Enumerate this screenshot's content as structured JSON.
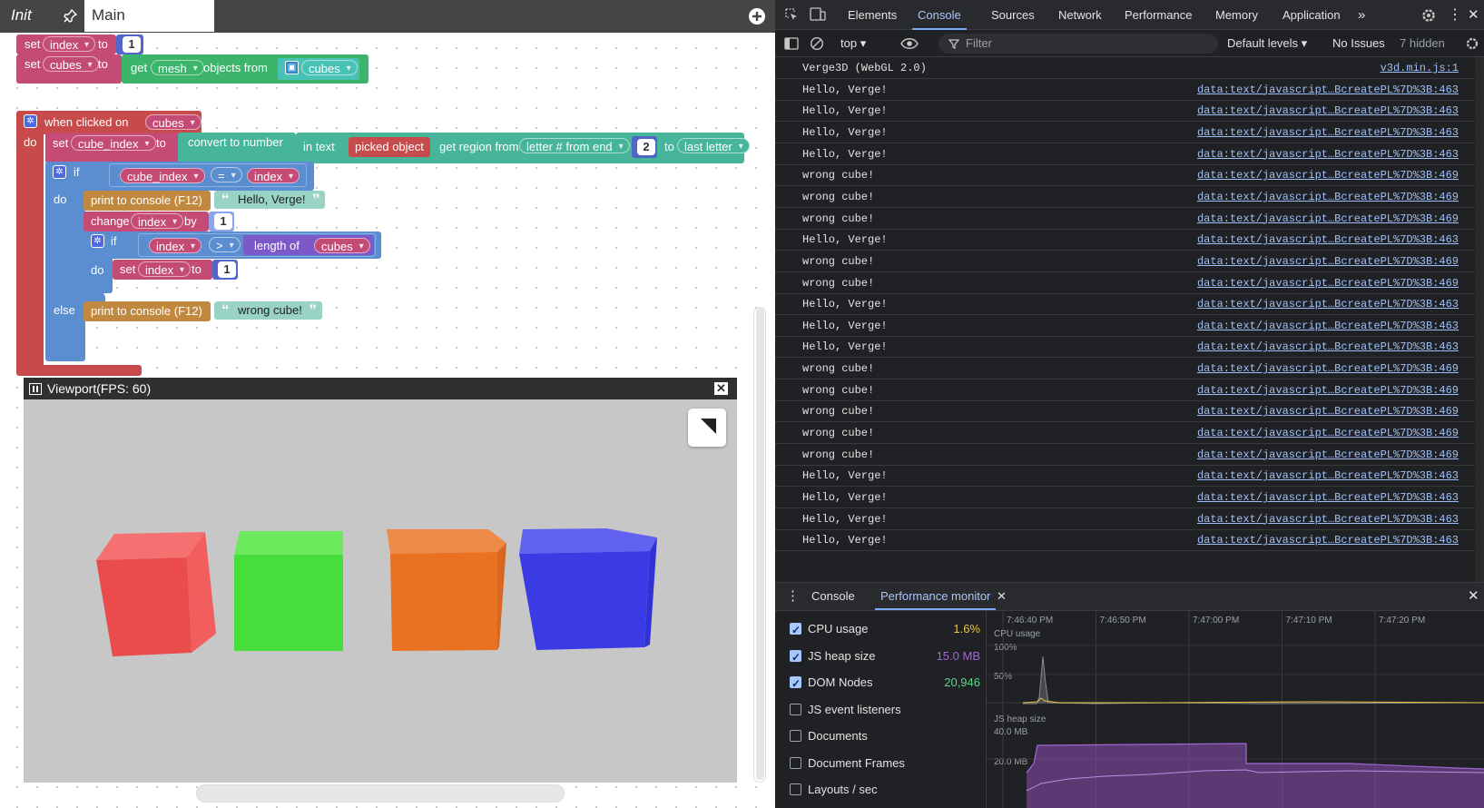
{
  "editor": {
    "tabs": {
      "init": "Init",
      "main": "Main"
    },
    "blocks": {
      "set1": {
        "set": "set",
        "var": "index",
        "to": "to",
        "value": "1"
      },
      "set2": {
        "set": "set",
        "var": "cubes",
        "to": "to",
        "get": "get",
        "type": "mesh",
        "objects_from": "objects from",
        "collection": "cubes"
      },
      "event": {
        "when_clicked_on": "when clicked on",
        "target": "cubes",
        "do": "do"
      },
      "set_cube_index": {
        "set": "set",
        "var": "cube_index",
        "to": "to",
        "convert": "convert to number",
        "in_text": "in text",
        "picked": "picked object",
        "region": "get region from",
        "letter_mode": "letter # from end",
        "n": "2",
        "to2": "to",
        "last_letter": "last letter"
      },
      "if1": {
        "if": "if",
        "left": "cube_index",
        "op": "=",
        "right": "index",
        "do": "do",
        "else": "else"
      },
      "print1": {
        "label": "print to console (F12)",
        "text": "Hello, Verge!"
      },
      "change": {
        "label": "change",
        "var": "index",
        "by": "by",
        "value": "1"
      },
      "if2": {
        "if": "if",
        "left": "index",
        "op": ">",
        "length_of": "length of",
        "list": "cubes",
        "do": "do"
      },
      "set_index": {
        "set": "set",
        "var": "index",
        "to": "to",
        "value": "1"
      },
      "print2": {
        "label": "print to console (F12)",
        "text": "wrong cube!"
      }
    },
    "viewport": {
      "title": "Viewport(FPS: 60)"
    },
    "cubes": [
      {
        "name": "red-cube",
        "front": "#ea4c4c",
        "side": "#f25e5e",
        "top": "#f57171"
      },
      {
        "name": "green-cube",
        "front": "#47dd3a",
        "side": "#53e445",
        "top": "#6bea5e"
      },
      {
        "name": "orange-cube",
        "front": "#e97222",
        "side": "#d8661c",
        "top": "#ef8a48"
      },
      {
        "name": "blue-cube",
        "front": "#3b3be6",
        "side": "#3232d4",
        "top": "#6161ef"
      }
    ]
  },
  "devtools": {
    "tabs": [
      "Elements",
      "Console",
      "Sources",
      "Network",
      "Performance",
      "Memory",
      "Application"
    ],
    "active_tab": "Console",
    "toolbar": {
      "context": "top",
      "filter_placeholder": "Filter",
      "levels": "Default levels",
      "issues": "No Issues",
      "hidden": "7 hidden"
    },
    "log": [
      {
        "msg": "Verge3D (WebGL 2.0)",
        "src": "v3d.min.js:1"
      },
      {
        "msg": "Hello, Verge!",
        "src": "data:text/javascript…BcreatePL%7D%3B:463"
      },
      {
        "msg": "Hello, Verge!",
        "src": "data:text/javascript…BcreatePL%7D%3B:463"
      },
      {
        "msg": "Hello, Verge!",
        "src": "data:text/javascript…BcreatePL%7D%3B:463"
      },
      {
        "msg": "Hello, Verge!",
        "src": "data:text/javascript…BcreatePL%7D%3B:463"
      },
      {
        "msg": "wrong cube!",
        "src": "data:text/javascript…BcreatePL%7D%3B:469"
      },
      {
        "msg": "wrong cube!",
        "src": "data:text/javascript…BcreatePL%7D%3B:469"
      },
      {
        "msg": "wrong cube!",
        "src": "data:text/javascript…BcreatePL%7D%3B:469"
      },
      {
        "msg": "Hello, Verge!",
        "src": "data:text/javascript…BcreatePL%7D%3B:463"
      },
      {
        "msg": "wrong cube!",
        "src": "data:text/javascript…BcreatePL%7D%3B:469"
      },
      {
        "msg": "wrong cube!",
        "src": "data:text/javascript…BcreatePL%7D%3B:469"
      },
      {
        "msg": "Hello, Verge!",
        "src": "data:text/javascript…BcreatePL%7D%3B:463"
      },
      {
        "msg": "Hello, Verge!",
        "src": "data:text/javascript…BcreatePL%7D%3B:463"
      },
      {
        "msg": "Hello, Verge!",
        "src": "data:text/javascript…BcreatePL%7D%3B:463"
      },
      {
        "msg": "wrong cube!",
        "src": "data:text/javascript…BcreatePL%7D%3B:469"
      },
      {
        "msg": "wrong cube!",
        "src": "data:text/javascript…BcreatePL%7D%3B:469"
      },
      {
        "msg": "wrong cube!",
        "src": "data:text/javascript…BcreatePL%7D%3B:469"
      },
      {
        "msg": "wrong cube!",
        "src": "data:text/javascript…BcreatePL%7D%3B:469"
      },
      {
        "msg": "wrong cube!",
        "src": "data:text/javascript…BcreatePL%7D%3B:469"
      },
      {
        "msg": "Hello, Verge!",
        "src": "data:text/javascript…BcreatePL%7D%3B:463"
      },
      {
        "msg": "Hello, Verge!",
        "src": "data:text/javascript…BcreatePL%7D%3B:463"
      },
      {
        "msg": "Hello, Verge!",
        "src": "data:text/javascript…BcreatePL%7D%3B:463"
      },
      {
        "msg": "Hello, Verge!",
        "src": "data:text/javascript…BcreatePL%7D%3B:463"
      }
    ],
    "drawer": {
      "tabs": [
        "Console",
        "Performance monitor"
      ],
      "active": "Performance monitor"
    },
    "perf": {
      "items": [
        {
          "label": "CPU usage",
          "value": "1.6%",
          "color": "#e8c34a",
          "checked": true
        },
        {
          "label": "JS heap size",
          "value": "15.0 MB",
          "color": "#a365d6",
          "checked": true
        },
        {
          "label": "DOM Nodes",
          "value": "20,946",
          "color": "#5fd38c",
          "checked": true
        },
        {
          "label": "JS event listeners",
          "value": "",
          "color": "",
          "checked": false
        },
        {
          "label": "Documents",
          "value": "",
          "color": "",
          "checked": false
        },
        {
          "label": "Document Frames",
          "value": "",
          "color": "",
          "checked": false
        },
        {
          "label": "Layouts / sec",
          "value": "",
          "color": "",
          "checked": false
        }
      ],
      "times": [
        "7:46:40 PM",
        "7:46:50 PM",
        "7:47:00 PM",
        "7:47:10 PM",
        "7:47:20 PM"
      ],
      "cpu_title": "CPU usage",
      "cpu_ticks": [
        "100%",
        "50%"
      ],
      "heap_title": "JS heap size",
      "heap_ticks": [
        "40.0 MB",
        "20.0 MB"
      ]
    }
  }
}
